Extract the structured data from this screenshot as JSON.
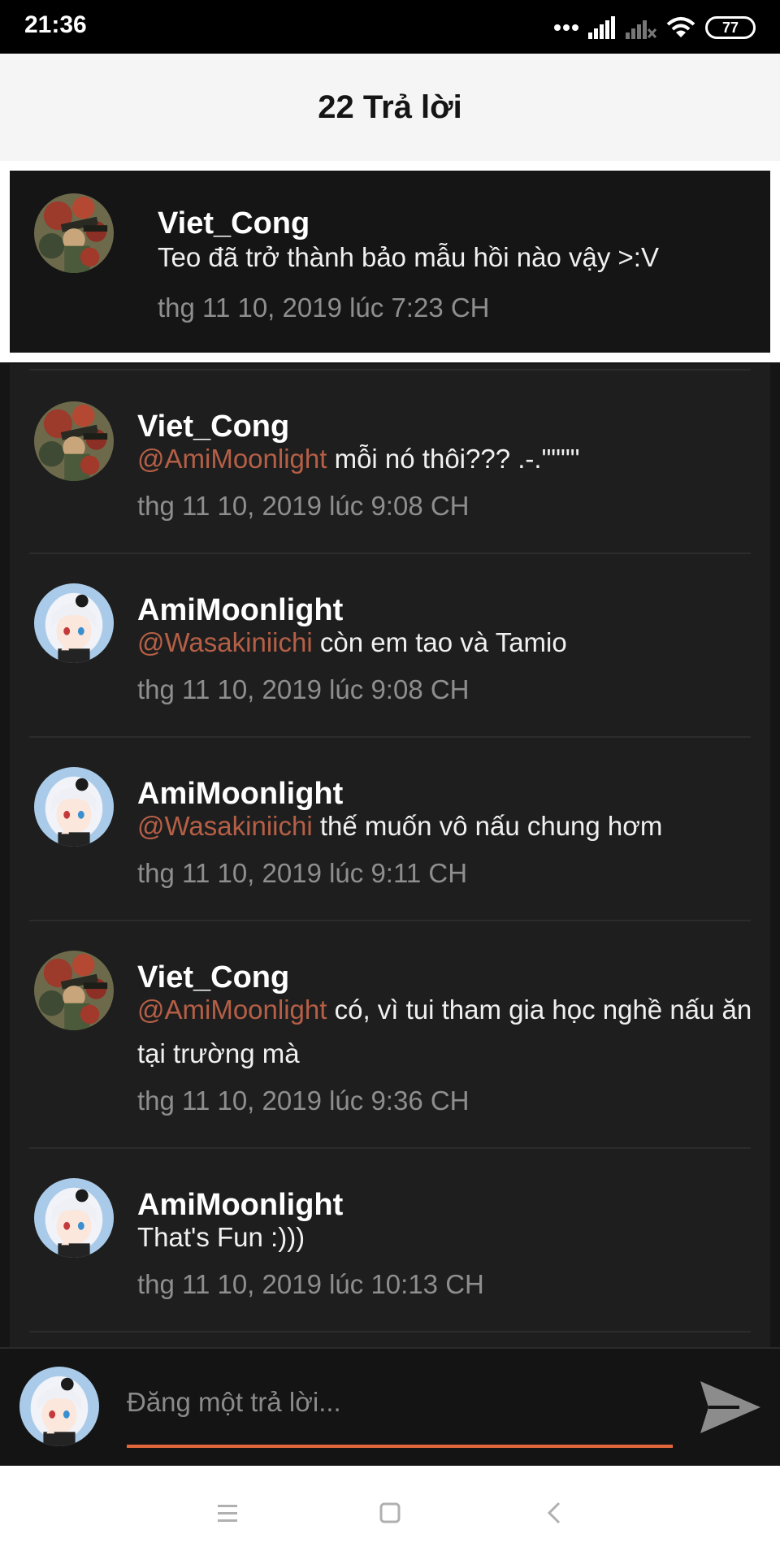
{
  "status_bar": {
    "time": "21:36",
    "battery": "77"
  },
  "header": {
    "title": "22 Trả lời"
  },
  "original_post": {
    "author": "Viet_Cong",
    "text": "Teo đã trở thành bảo mẫu hồi nào vậy >:V",
    "time": "thg 11 10, 2019 lúc 7:23 CH",
    "avatar": "soldier-avatar"
  },
  "replies": [
    {
      "author": "Viet_Cong",
      "mention": "@AmiMoonlight",
      "text": " mỗi nó thôi??? .-.\"\"\"\"",
      "time": "thg 11 10, 2019 lúc 9:08 CH",
      "avatar": "soldier-avatar"
    },
    {
      "author": "AmiMoonlight",
      "mention": "@Wasakiniichi",
      "text": " còn em tao và Tamio",
      "time": "thg 11 10, 2019 lúc 9:08 CH",
      "avatar": "anime-girl-avatar"
    },
    {
      "author": "AmiMoonlight",
      "mention": "@Wasakiniichi",
      "text": " thế muốn vô nấu chung hơm",
      "time": "thg 11 10, 2019 lúc 9:11 CH",
      "avatar": "anime-girl-avatar"
    },
    {
      "author": "Viet_Cong",
      "mention": "@AmiMoonlight",
      "text": " có, vì tui tham gia học nghề nấu ăn tại trường mà",
      "time": "thg 11 10, 2019 lúc 9:36 CH",
      "avatar": "soldier-avatar"
    },
    {
      "author": "AmiMoonlight",
      "mention": "",
      "text": "That's Fun :)))",
      "time": "thg 11 10, 2019 lúc 10:13 CH",
      "avatar": "anime-girl-avatar"
    }
  ],
  "reply_bar": {
    "placeholder": "Đăng một trả lời...",
    "send_icon": "send-icon"
  },
  "colors": {
    "mention": "#b55f46",
    "accent": "#e2663b",
    "header_bg": "#f5f5f5",
    "panel_bg": "#1e1e1e"
  }
}
